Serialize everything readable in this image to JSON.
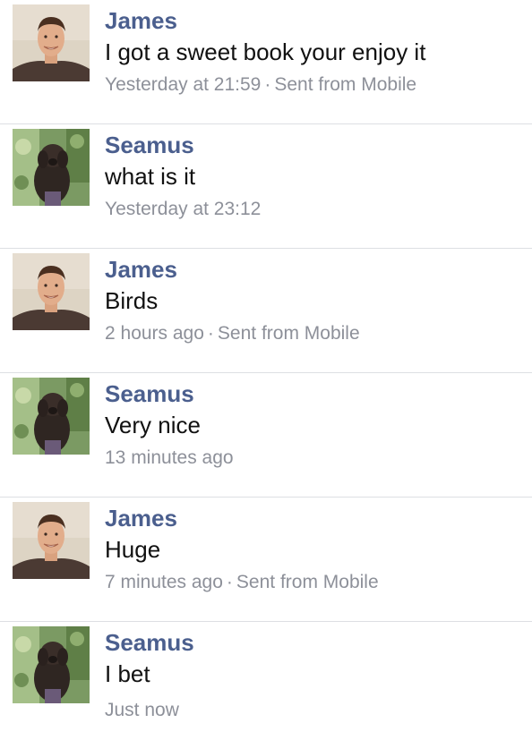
{
  "messages": [
    {
      "sender": "James",
      "avatar": "james-photo",
      "text": "I got a sweet book your enjoy it",
      "time": "Yesterday at 21:59",
      "source": "Sent from Mobile"
    },
    {
      "sender": "Seamus",
      "avatar": "seamus-dog-photo",
      "text": "what is it",
      "time": "Yesterday at 23:12",
      "source": ""
    },
    {
      "sender": "James",
      "avatar": "james-photo",
      "text": "Birds",
      "time": "2 hours ago",
      "source": "Sent from Mobile"
    },
    {
      "sender": "Seamus",
      "avatar": "seamus-dog-photo",
      "text": "Very nice",
      "time": "13 minutes ago",
      "source": ""
    },
    {
      "sender": "James",
      "avatar": "james-photo",
      "text": "Huge",
      "time": "7 minutes ago",
      "source": "Sent from Mobile"
    },
    {
      "sender": "Seamus",
      "avatar": "seamus-dog-photo",
      "text": "I bet",
      "time": "Just now",
      "source": ""
    }
  ],
  "separator": "·",
  "colors": {
    "sender": "#4b5f8e",
    "text": "#111111",
    "meta": "#8d9099",
    "divider": "#dddfe3"
  }
}
